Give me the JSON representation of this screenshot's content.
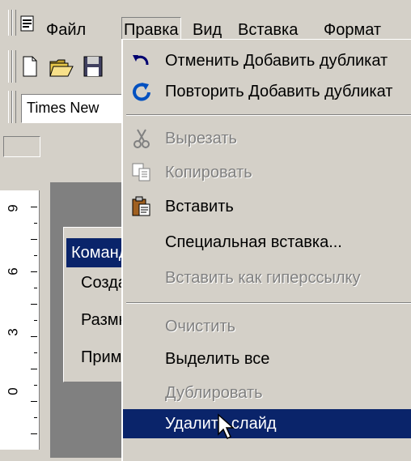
{
  "menubar": {
    "items": [
      {
        "label": "Файл"
      },
      {
        "label": "Правка"
      },
      {
        "label": "Вид"
      },
      {
        "label": "Вставка"
      },
      {
        "label": "Формат"
      }
    ]
  },
  "toolbar": {
    "font_name": "Times New"
  },
  "ruler": {
    "labels": [
      "9",
      "6",
      "3",
      "0"
    ]
  },
  "commands_panel": {
    "title": "Команды",
    "items": [
      "Создать",
      "Размножить",
      "Применить"
    ]
  },
  "edit_menu": {
    "items": [
      {
        "label": "Отменить Добавить дубликат",
        "icon": "undo-icon",
        "enabled": true
      },
      {
        "label": "Повторить Добавить дубликат",
        "icon": "redo-icon",
        "enabled": true
      },
      {
        "label": "Вырезать",
        "icon": "cut-icon",
        "enabled": false
      },
      {
        "label": "Копировать",
        "icon": "copy-icon",
        "enabled": false
      },
      {
        "label": "Вставить",
        "icon": "paste-icon",
        "enabled": true
      },
      {
        "label": "Специальная вставка...",
        "enabled": true
      },
      {
        "label": "Вставить как гиперссылку",
        "enabled": false
      },
      {
        "label": "Очистить",
        "enabled": false
      },
      {
        "label": "Выделить все",
        "enabled": true
      },
      {
        "label": "Дублировать",
        "enabled": false
      },
      {
        "label": "Удалить слайд",
        "enabled": true,
        "selected": true
      }
    ]
  },
  "colors": {
    "face": "#d4d0c8",
    "highlight": "#0a246a",
    "disabled": "#808080"
  }
}
